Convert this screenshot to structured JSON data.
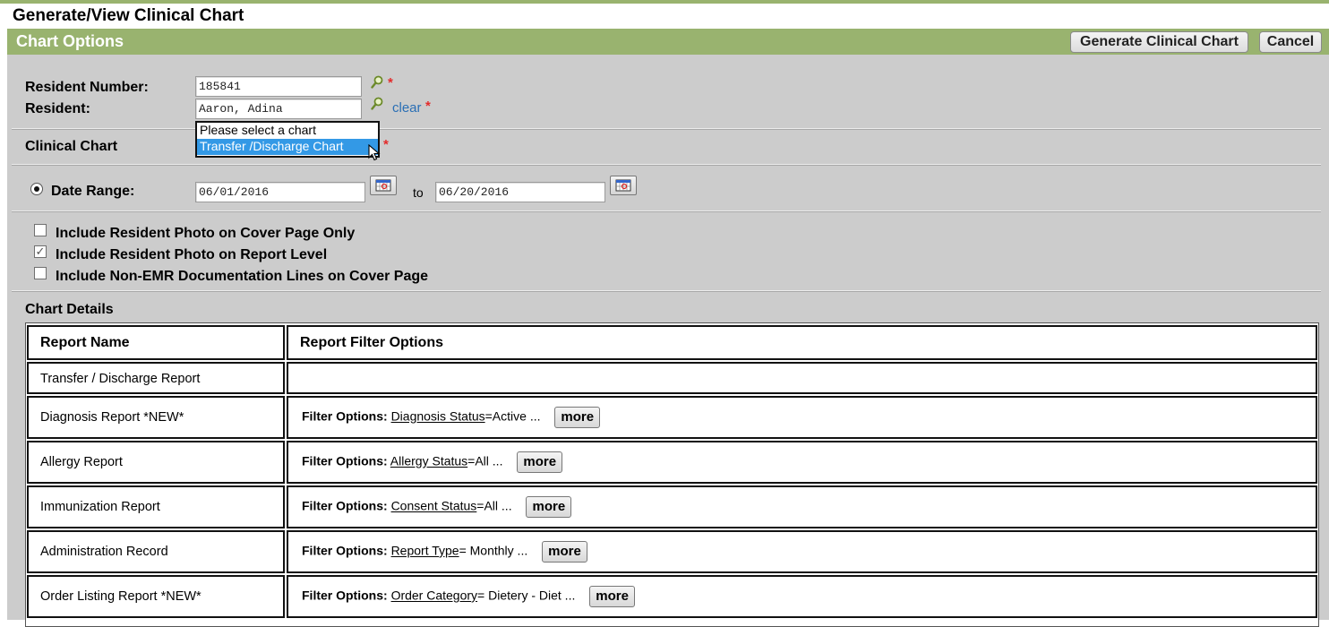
{
  "page_title": "Generate/View Clinical Chart",
  "panel": {
    "title": "Chart Options",
    "generate_label": "Generate Clinical Chart",
    "cancel_label": "Cancel"
  },
  "form": {
    "resident_number_label": "Resident Number:",
    "resident_number_value": "185841",
    "resident_label": "Resident:",
    "resident_value": "Aaron, Adina",
    "clear_label": "clear",
    "required_mark": "*",
    "clinical_chart_label": "Clinical Chart",
    "chart_options": [
      "Please select a chart",
      "Transfer /Discharge Chart"
    ],
    "date_range_label": "Date Range:",
    "date_from": "06/01/2016",
    "date_to_label": "to",
    "date_to": "06/20/2016"
  },
  "checkboxes": [
    {
      "label": "Include Resident Photo on Cover Page Only",
      "checked": false
    },
    {
      "label": "Include Resident Photo on Report Level",
      "checked": true
    },
    {
      "label": "Include Non-EMR Documentation Lines on Cover Page",
      "checked": false
    }
  ],
  "chart_details": {
    "title": "Chart Details",
    "col_report": "Report Name",
    "col_filter": "Report Filter Options",
    "filter_prefix": "Filter Options:",
    "more_label": "more",
    "rows": [
      {
        "name": "Transfer / Discharge Report",
        "filter_key": "",
        "filter_value": ""
      },
      {
        "name": "Diagnosis Report *NEW*",
        "filter_key": "Diagnosis Status",
        "filter_value": "=Active ..."
      },
      {
        "name": "Allergy Report",
        "filter_key": "Allergy Status",
        "filter_value": "=All ..."
      },
      {
        "name": "Immunization Report",
        "filter_key": "Consent Status",
        "filter_value": "=All ..."
      },
      {
        "name": "Administration Record",
        "filter_key": "Report Type",
        "filter_value": "= Monthly ..."
      },
      {
        "name": "Order Listing Report *NEW*",
        "filter_key": "Order Category",
        "filter_value": "= Dietery - Diet ..."
      }
    ]
  }
}
